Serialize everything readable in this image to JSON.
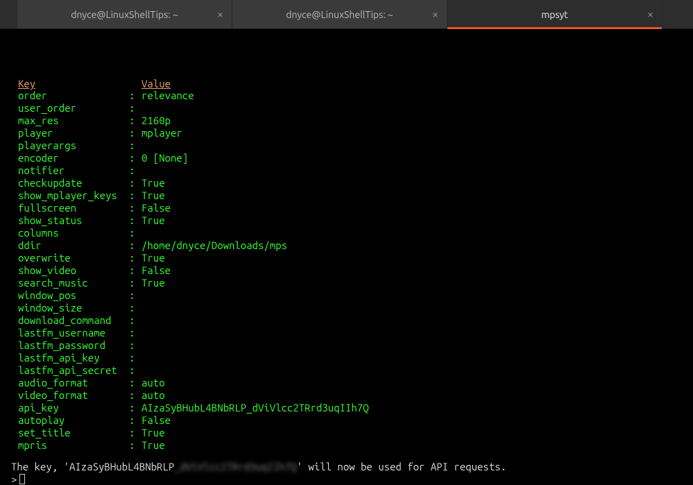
{
  "tabs": [
    {
      "label": "dnyce@LinuxShellTips: ~",
      "active": false
    },
    {
      "label": "dnyce@LinuxShellTips: ~",
      "active": false
    },
    {
      "label": "mpsyt",
      "active": true
    }
  ],
  "headers": {
    "key": "Key",
    "value": "Value"
  },
  "settings": [
    {
      "key": "order",
      "value": "relevance"
    },
    {
      "key": "user_order",
      "value": ""
    },
    {
      "key": "max_res",
      "value": "2160p"
    },
    {
      "key": "player",
      "value": "mplayer"
    },
    {
      "key": "playerargs",
      "value": ""
    },
    {
      "key": "encoder",
      "value": "0 [None]"
    },
    {
      "key": "notifier",
      "value": ""
    },
    {
      "key": "checkupdate",
      "value": "True"
    },
    {
      "key": "show_mplayer_keys",
      "value": "True"
    },
    {
      "key": "fullscreen",
      "value": "False"
    },
    {
      "key": "show_status",
      "value": "True"
    },
    {
      "key": "columns",
      "value": ""
    },
    {
      "key": "ddir",
      "value": "/home/dnyce/Downloads/mps"
    },
    {
      "key": "overwrite",
      "value": "True"
    },
    {
      "key": "show_video",
      "value": "False"
    },
    {
      "key": "search_music",
      "value": "True"
    },
    {
      "key": "window_pos",
      "value": ""
    },
    {
      "key": "window_size",
      "value": ""
    },
    {
      "key": "download_command",
      "value": ""
    },
    {
      "key": "lastfm_username",
      "value": ""
    },
    {
      "key": "lastfm_password",
      "value": ""
    },
    {
      "key": "lastfm_api_key",
      "value": ""
    },
    {
      "key": "lastfm_api_secret",
      "value": ""
    },
    {
      "key": "audio_format",
      "value": "auto"
    },
    {
      "key": "video_format",
      "value": "auto"
    },
    {
      "key": "api_key",
      "value": "AIzaSyBHubL4BNbRLP_dViVlcc2TRrd3uqIIh7Q"
    },
    {
      "key": "autoplay",
      "value": "False"
    },
    {
      "key": "set_title",
      "value": "True"
    },
    {
      "key": "mpris",
      "value": "True"
    }
  ],
  "status": {
    "prefix": "The key, '",
    "key_visible": "AIzaSyBHubL4BNbRLP",
    "key_blurred": "_dViVlcc2TRrd3uqIIh7Q",
    "suffix": "' will now be used for API requests."
  },
  "prompt": ">"
}
